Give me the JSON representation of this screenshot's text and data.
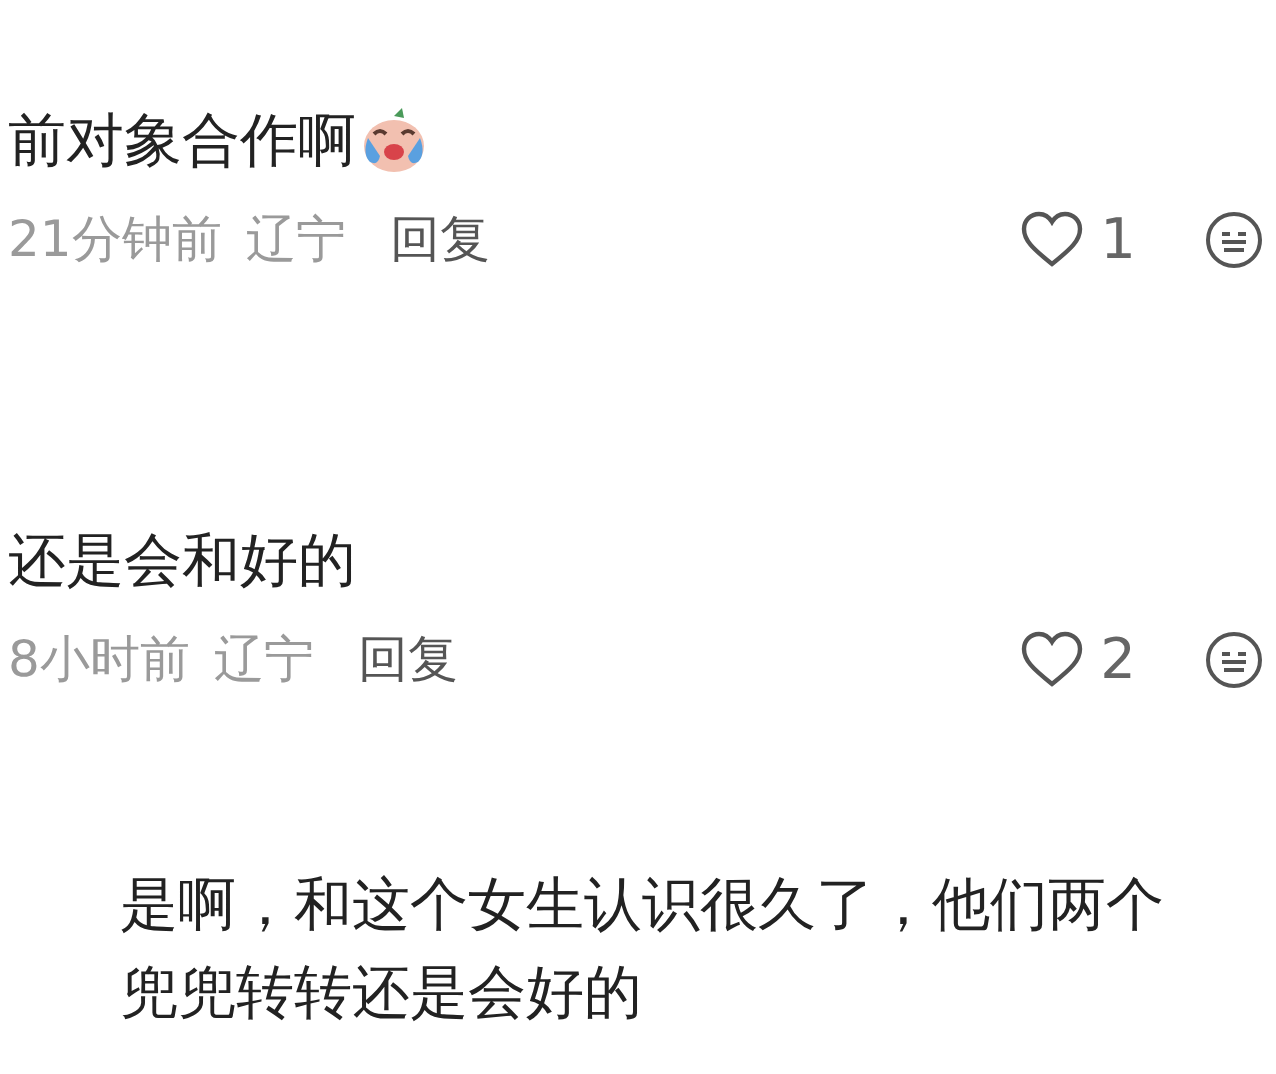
{
  "comments": [
    {
      "text": "前对象合作啊",
      "has_sticker": true,
      "time": "21分钟前",
      "location": "辽宁",
      "reply": "回复",
      "likes": "1"
    },
    {
      "text": "还是会和好的",
      "has_sticker": false,
      "time": "8小时前",
      "location": "辽宁",
      "reply": "回复",
      "likes": "2"
    }
  ],
  "caption": "是啊，和这个女生认识很久了，他们两个兜兜转转还是会好的"
}
